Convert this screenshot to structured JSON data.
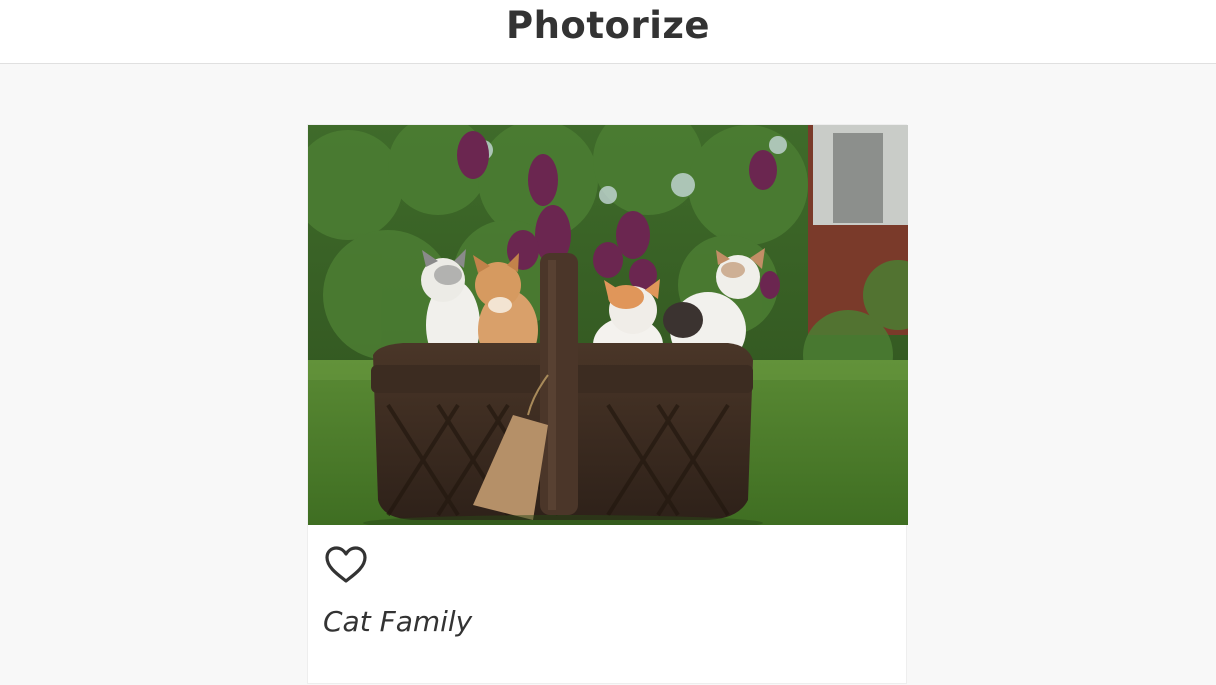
{
  "header": {
    "title": "Photorize"
  },
  "post": {
    "image_alt": "Cat Family",
    "like_icon": "heart-outline-icon",
    "caption": "Cat Family"
  },
  "colors": {
    "background": "#f8f8f8",
    "header_bg": "#ffffff",
    "text": "#333333"
  }
}
